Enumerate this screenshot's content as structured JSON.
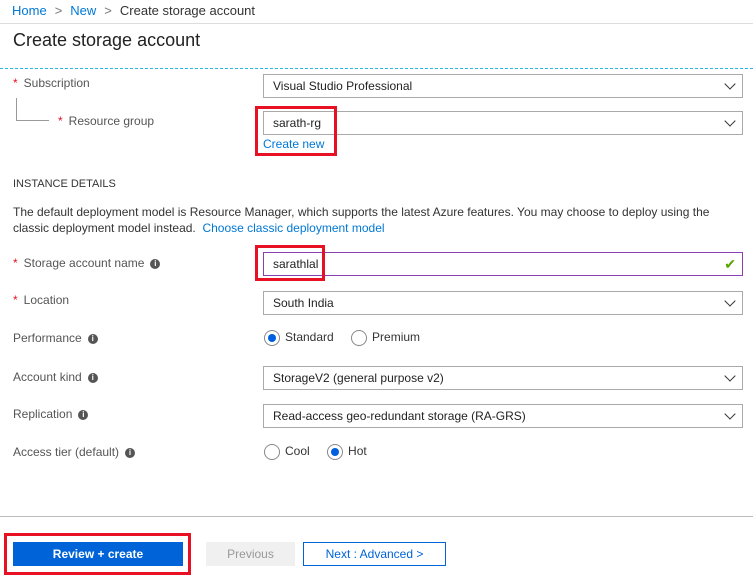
{
  "breadcrumb": {
    "home": "Home",
    "new": "New",
    "current": "Create storage account"
  },
  "title": "Create storage account",
  "subscription": {
    "label": "Subscription",
    "value": "Visual Studio Professional"
  },
  "resource_group": {
    "label": "Resource group",
    "value": "sarath-rg",
    "create_new": "Create new"
  },
  "instance": {
    "heading": "INSTANCE DETAILS",
    "text": "The default deployment model is Resource Manager, which supports the latest Azure features. You may choose to deploy using the classic deployment model instead.",
    "link": "Choose classic deployment model"
  },
  "storage_name": {
    "label": "Storage account name",
    "value": "sarathlal"
  },
  "location": {
    "label": "Location",
    "value": "South India"
  },
  "performance": {
    "label": "Performance",
    "options": [
      "Standard",
      "Premium"
    ],
    "selected": "Standard"
  },
  "account_kind": {
    "label": "Account kind",
    "value": "StorageV2 (general purpose v2)"
  },
  "replication": {
    "label": "Replication",
    "value": "Read-access geo-redundant storage (RA-GRS)"
  },
  "access_tier": {
    "label": "Access tier (default)",
    "options": [
      "Cool",
      "Hot"
    ],
    "selected": "Hot"
  },
  "buttons": {
    "review": "Review + create",
    "previous": "Previous",
    "next": "Next : Advanced >"
  }
}
